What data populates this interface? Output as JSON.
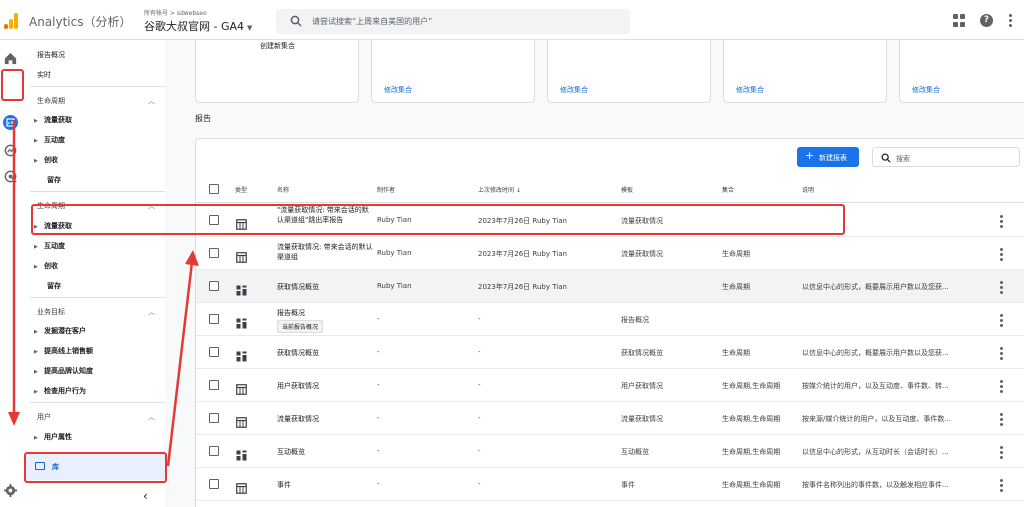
{
  "app": {
    "title": "Analytics（分析）",
    "account_path": "所有帐号 > sdwebseo",
    "property": "谷歌大叔官网 - GA4"
  },
  "search": {
    "placeholder": "请尝试搜索“上周来自美国的用户”"
  },
  "sidenav": {
    "top": [
      "报告概况",
      "实时"
    ],
    "sections": [
      {
        "title": "生命周期",
        "items": [
          "流量获取",
          "互动度",
          "创收"
        ],
        "extra": "留存"
      },
      {
        "title": "生命周期",
        "items": [
          "流量获取",
          "互动度",
          "创收"
        ],
        "extra": "留存"
      },
      {
        "title": "业务目标",
        "items": [
          "发掘潜在客户",
          "提高线上销售额",
          "提高品牌认知度",
          "检查用户行为"
        ]
      },
      {
        "title": "用户",
        "items": [
          "用户属性"
        ]
      }
    ],
    "library": "库"
  },
  "collections": {
    "create_label": "创建新集合",
    "edit_label": "修改集合"
  },
  "reports": {
    "title": "报告",
    "new_button": "新建报表",
    "search_placeholder": "搜索",
    "headers": [
      "类型",
      "名称",
      "制作者",
      "上次修改时间",
      "模板",
      "集合",
      "说明"
    ],
    "rows": [
      {
        "type": "table",
        "name": "\"流量获取情况: 带来会话的默认渠道组\"跳出率报告",
        "creator": "Ruby Tian",
        "modified": "2023年7月26日 Ruby Tian",
        "template": "流量获取情况",
        "collection": "",
        "desc": "",
        "chip": ""
      },
      {
        "type": "table",
        "name": "流量获取情况: 带来会话的默认渠道组",
        "creator": "Ruby Tian",
        "modified": "2023年7月26日 Ruby Tian",
        "template": "流量获取情况",
        "collection": "生命周期",
        "desc": "",
        "chip": ""
      },
      {
        "type": "overview",
        "name": "获取情况概览",
        "creator": "Ruby Tian",
        "modified": "2023年7月26日 Ruby Tian",
        "template": "",
        "collection": "生命周期",
        "desc": "以信息中心的形式，概要展示用户数以及您获...",
        "chip": ""
      },
      {
        "type": "overview",
        "name": "报告概况",
        "creator": "-",
        "modified": "-",
        "template": "报告概况",
        "collection": "",
        "desc": "",
        "chip": "当前报告概况"
      },
      {
        "type": "overview",
        "name": "获取情况概览",
        "creator": "-",
        "modified": "-",
        "template": "获取情况概览",
        "collection": "生命周期",
        "desc": "以信息中心的形式，概要展示用户数以及您获...",
        "chip": ""
      },
      {
        "type": "table",
        "name": "用户获取情况",
        "creator": "-",
        "modified": "-",
        "template": "用户获取情况",
        "collection": "生命周期,生命周期",
        "desc": "按媒介统计的用户，以及互动度、事件数、转...",
        "chip": ""
      },
      {
        "type": "table",
        "name": "流量获取情况",
        "creator": "-",
        "modified": "-",
        "template": "流量获取情况",
        "collection": "生命周期,生命周期",
        "desc": "按来源/媒介统计的用户，以及互动度、事件数...",
        "chip": ""
      },
      {
        "type": "overview",
        "name": "互动概览",
        "creator": "-",
        "modified": "-",
        "template": "互动概览",
        "collection": "生命周期,生命周期",
        "desc": "以信息中心的形式，从互动时长（会话时长）...",
        "chip": ""
      },
      {
        "type": "table",
        "name": "事件",
        "creator": "-",
        "modified": "-",
        "template": "事件",
        "collection": "生命周期,生命周期",
        "desc": "按事件名称列出的事件数，以及触发相应事件...",
        "chip": ""
      }
    ]
  },
  "colors": {
    "accent": "#1a73e8",
    "annotation": "#e53935",
    "brand": "#f9ab00"
  }
}
